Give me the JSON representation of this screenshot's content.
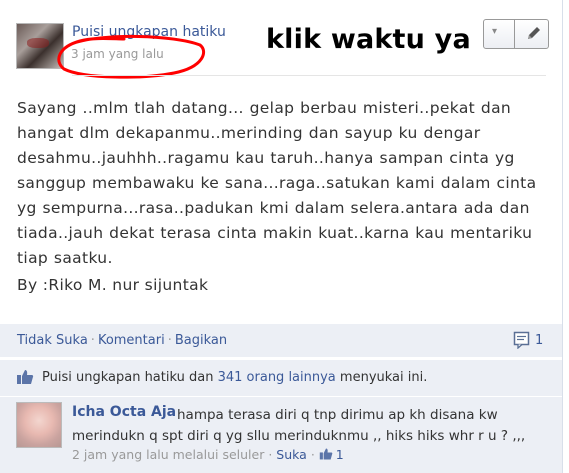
{
  "post": {
    "page_name": "Puisi ungkapan hatiku",
    "timestamp": "3 jam yang lalu",
    "annotation": "klik waktu ya",
    "body": "Sayang ..mlm tlah datang... gelap berbau misteri..pekat dan hangat dlm dekapanmu..merinding dan sayup ku dengar desahmu..jauhhh..ragamu kau taruh..hanya sampan cinta yg sanggup membawaku ke sana...raga..satukan kami dalam cinta yg sempurna...rasa..padukan kmi dalam selera.antara ada dan tiada..jauh dekat terasa cinta makin kuat..karna kau mentariku tiap saatku.",
    "signature": "By :Riko M. nur sijuntak"
  },
  "actions": {
    "unlike": "Tidak Suka",
    "comment": "Komentari",
    "share": "Bagikan",
    "separator": "·",
    "comment_count": "1"
  },
  "likes": {
    "name": "Puisi ungkapan hatiku",
    "connector": "dan",
    "others": "341 orang lainnya",
    "suffix": "menyukai ini."
  },
  "comment": {
    "author": "Icha Octa Aja",
    "text": "hampa terasa diri q tnp dirimu ap kh disana kw merindukn q spt diri q yg sllu merinduknmu ,, hiks hiks whr r u ? ,,,",
    "time": "2 jam yang lalu melalui seluler",
    "like_label": "Suka",
    "like_count": "1"
  },
  "icons": {
    "edit": "pencil-icon",
    "dropdown": "chevron-down-icon",
    "comments": "comment-bubble-icon",
    "like": "thumbs-up-icon"
  },
  "colors": {
    "link": "#3b5998",
    "panel": "#eceff5",
    "annotation_ring": "#ff0000"
  }
}
